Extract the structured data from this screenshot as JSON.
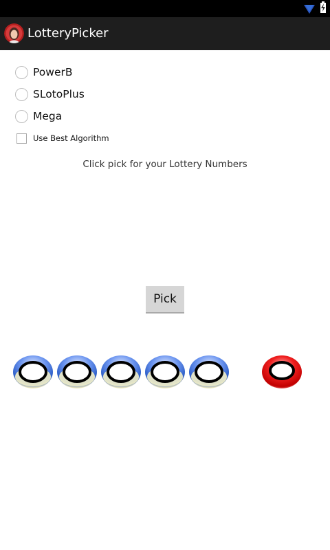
{
  "status_bar": {
    "wifi_icon": "wifi-icon",
    "battery_icon": "battery-charging-icon"
  },
  "action_bar": {
    "app_icon": "app-avatar-icon",
    "title": "LotteryPicker"
  },
  "lottery_options": [
    {
      "label": "PowerB",
      "selected": false
    },
    {
      "label": "SLotoPlus",
      "selected": false
    },
    {
      "label": "Mega",
      "selected": false
    }
  ],
  "best_algorithm": {
    "label": "Use Best Algorithm",
    "checked": false
  },
  "instruction": "Click pick for your Lottery Numbers",
  "pick_button": {
    "label": "Pick"
  },
  "balls": {
    "regular": [
      {
        "number": ""
      },
      {
        "number": ""
      },
      {
        "number": ""
      },
      {
        "number": ""
      },
      {
        "number": ""
      }
    ],
    "special": {
      "number": ""
    },
    "colors": {
      "regular": "#3d6fe0",
      "special": "#e01010"
    }
  }
}
